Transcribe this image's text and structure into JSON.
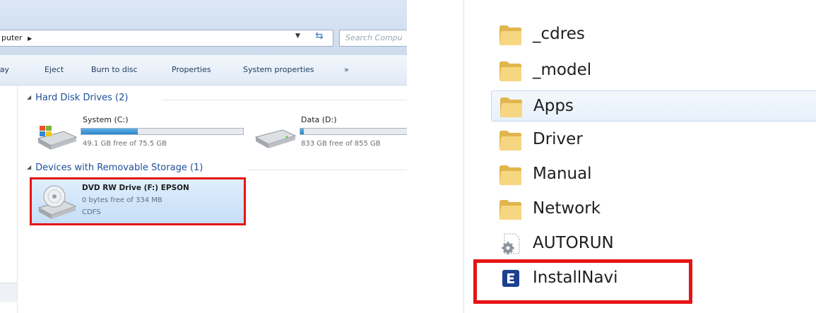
{
  "explorer": {
    "address_text": "puter",
    "search_placeholder": "Search Compu",
    "toolbar": {
      "play": "Play",
      "eject": "Eject",
      "burn": "Burn to disc",
      "properties": "Properties",
      "system_properties": "System properties",
      "more": "»"
    },
    "groups": [
      {
        "label": "Hard Disk Drives (2)"
      },
      {
        "label": "Devices with Removable Storage (1)"
      }
    ],
    "drives": [
      {
        "name": "System (C:)",
        "free": "49.1 GB free of 75.5 GB",
        "used_fraction": 0.35
      },
      {
        "name": "Data (D:)",
        "free": "833 GB free of 855 GB",
        "used_fraction": 0.03
      }
    ],
    "dvd": {
      "name": "DVD RW Drive (F:) EPSON",
      "free": "0 bytes free of 334 MB",
      "fs": "CDFS"
    }
  },
  "folder_list": {
    "items": [
      {
        "label": "_cdres",
        "type": "folder"
      },
      {
        "label": "_model",
        "type": "folder"
      },
      {
        "label": "Apps",
        "type": "folder"
      },
      {
        "label": "Driver",
        "type": "folder"
      },
      {
        "label": "Manual",
        "type": "folder"
      },
      {
        "label": "Network",
        "type": "folder"
      },
      {
        "label": "AUTORUN",
        "type": "settings-file"
      },
      {
        "label": "InstallNavi",
        "type": "application"
      }
    ]
  },
  "colors": {
    "highlight_red": "#e51414",
    "selection_blue": "#c6def7",
    "folder_yellow": "#f2cf6b"
  }
}
